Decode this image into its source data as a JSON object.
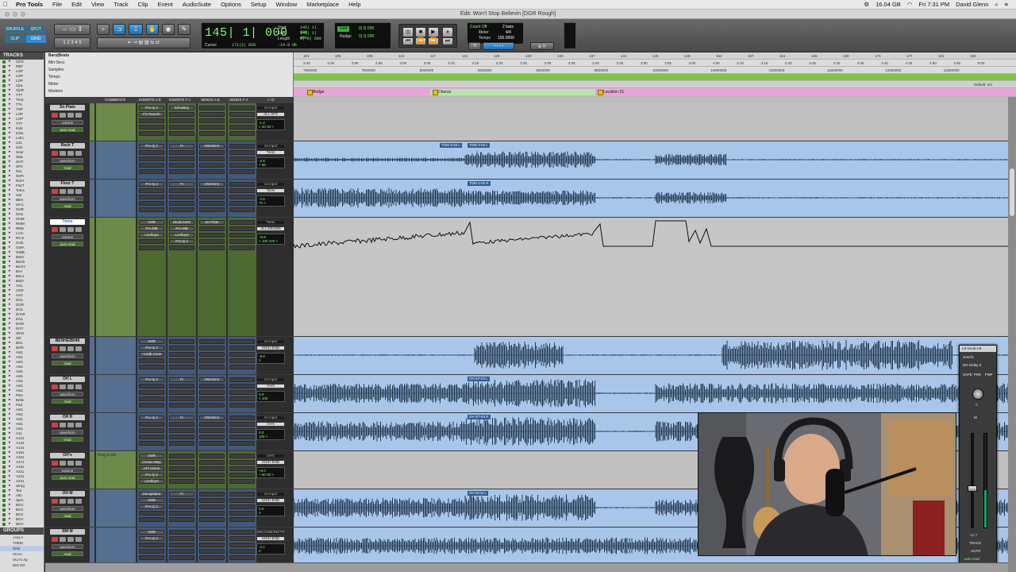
{
  "menubar": {
    "app": "Pro Tools",
    "menus": [
      "File",
      "Edit",
      "View",
      "Track",
      "Clip",
      "Event",
      "AudioSuite",
      "Options",
      "Setup",
      "Window",
      "Marketplace",
      "Help"
    ],
    "status": {
      "disk": "16.04 GB",
      "clock": "Fri 7:31 PM",
      "user": "David Glenn"
    }
  },
  "window": {
    "title": "Edit: Won't Stop Believin [DGR Rough]"
  },
  "toolbar": {
    "modes": [
      "SHUFFLE",
      "SPOT",
      "SLIP",
      "GRID"
    ],
    "counter_main": "145| 1| 000",
    "counter_labels": [
      "Start",
      "End",
      "Length"
    ],
    "counter_values": [
      "145| 1| 000",
      "145| 1| 000",
      "0| 0| 000"
    ],
    "cursor_label": "Cursor",
    "cursor_value": "171|2| 820",
    "cursor_db": "-14.0 db",
    "grid_label": "Grid",
    "grid_value": "0| 2| 000",
    "nudge_label": "Nudge",
    "nudge_value": "0| 1| 000",
    "countoff": "Count Off",
    "countoff_bars": "2 bars",
    "meter_label": "Meter",
    "meter_value": "4/4",
    "tempo_label": "Tempo",
    "tempo_value": "150.0000"
  },
  "tracks_panel": {
    "header": "TRACKS",
    "items": [
      "Click",
      "REF",
      "LOP",
      "LOP",
      "LOP",
      "ClpL",
      "ClpR",
      "TTT",
      "TrnS",
      "TTA",
      "TSP",
      "LOP",
      "LOP",
      "TTT",
      "Kick",
      "KckL",
      "LoKc",
      "U11",
      "Kick",
      "Snar",
      "SML",
      "SnTr",
      "SPC",
      "SnL",
      "SnPt",
      "RckT",
      "FlorT",
      "Toms",
      "Hat",
      "BEH",
      "OH L",
      "OHR",
      "OHs",
      "OHM",
      "RMM",
      "RMS",
      "LCm",
      "RCm",
      "Crsh",
      "GWA",
      "GWB",
      "BsDI",
      "BsCb",
      "BsAm",
      "BsA",
      "BsLn",
      "BsDr",
      "AGL",
      "AGR",
      "AcG",
      "DGL",
      "DGR",
      "DGL",
      "DrmR",
      "DGL",
      "DGR",
      "DGT",
      "SlrGt",
      "Sl2",
      "BGL",
      "BGR",
      "Ast1",
      "Ast1",
      "Ast1",
      "Ast1",
      "Ast1",
      "Ast1",
      "Ast1",
      "Ast1",
      "Ast1",
      "Plan",
      "Belle",
      "Pad",
      "Ast1",
      "Ast1",
      "Ast1",
      "Ast1",
      "Ast1",
      "A11",
      "A121",
      "A131",
      "A141",
      "A151",
      "A161",
      "A171",
      "A181",
      "A211",
      "A221",
      "A231",
      "Strng",
      "Ten",
      "Alto",
      "Sprn",
      "BGV",
      "BGV",
      "BGV",
      "BGV",
      "BGV"
    ]
  },
  "groups_panel": {
    "header": "GROUPS",
    "items": [
      "<ALL>",
      "TOMS",
      "OHs",
      "VCAs",
      "VCA's Ap",
      "Dist Grt"
    ]
  },
  "rulers": {
    "labels": [
      "Bars|Beats",
      "Min:Secs",
      "Samples",
      "Tempo",
      "Meter",
      "Markers"
    ],
    "bars": [
      "101",
      "105",
      "109",
      "113",
      "117",
      "121",
      "125",
      "129",
      "133",
      "137",
      "141",
      "145",
      "149",
      "153",
      "157",
      "161",
      "165",
      "169",
      "173",
      "177",
      "181",
      "185"
    ],
    "mins": [
      "2:40",
      "2:45",
      "2:50",
      "2:55",
      "3:00",
      "3:05",
      "3:10",
      "3:15",
      "3:20",
      "3:25",
      "3:30",
      "3:35",
      "3:40",
      "3:45",
      "3:50",
      "3:55",
      "4:00",
      "4:05",
      "4:10",
      "4:15",
      "4:20",
      "4:25",
      "4:30",
      "4:35",
      "4:40",
      "4:45",
      "4:50",
      "4:55",
      "5:00"
    ],
    "samples": [
      "7000000",
      "7500000",
      "8000000",
      "8500000",
      "9000000",
      "9500000",
      "10000000",
      "10500000",
      "11000000",
      "11500000",
      "12000000",
      "12500000"
    ],
    "meter_default": "Default: 4/4",
    "markers": [
      {
        "name": "Bridge",
        "color": "#e7a6d7"
      },
      {
        "name": "Chorus",
        "color": "#b7e6a9"
      },
      {
        "name": "Location 15",
        "color": "#e7a6d7"
      }
    ]
  },
  "column_headers": [
    "COMMENTS",
    "INSERTS A-E",
    "INSERTS F-J",
    "SENDS A-E",
    "SENDS F-J",
    "I / O"
  ],
  "edit_tracks": [
    {
      "name": "Sn Plate",
      "type": "empty",
      "view": "volume",
      "mode": "auto read",
      "color": "#6d8a4b",
      "comment": "",
      "inserts_ae": [
        "Pro-Q 2",
        "FX Reverb"
      ],
      "inserts_fj": [
        "EchoBoy"
      ],
      "sends_ae": [],
      "io": [
        "no input",
        "ALL SFX"
      ],
      "vol": "-1.4",
      "pan": "< 30   30 >",
      "clips": []
    },
    {
      "name": "Rack T",
      "type": "audio",
      "view": "waveform",
      "mode": "read",
      "color": "#556f90",
      "comment": "",
      "inserts_ae": [
        "Pro-Q 2"
      ],
      "inserts_fj": [
        "FI"
      ],
      "sends_ae": [
        "OWADrm"
      ],
      "io": [
        "no input",
        "Toms"
      ],
      "vol": "-2.6",
      "pan": "< 60",
      "clips": [
        "TOM 3-04 L",
        "TOM 3-04 L"
      ]
    },
    {
      "name": "Floor T",
      "type": "audio",
      "view": "waveform",
      "mode": "read",
      "color": "#556f90",
      "comment": "",
      "inserts_ae": [
        "Pro-Q 2"
      ],
      "inserts_fj": [
        "FI"
      ],
      "sends_ae": [
        "OWADrm"
      ],
      "io": [
        "no input",
        "Toms"
      ],
      "vol": "-2.6",
      "pan": "70 >",
      "clips": [
        "TOM 4-04 R"
      ]
    },
    {
      "name": "Toms",
      "type": "automation",
      "view": "volume",
      "mode": "auto read",
      "color": "#6d8a4b",
      "comment": "",
      "inserts_ae": [
        "VMR",
        "Pro-MB",
        "L2Alloy3"
      ],
      "inserts_fj": [
        "StudioVerb",
        "Pro-MB",
        "L2Alloy3",
        "Pro-Q 2"
      ],
      "sends_ae": [
        "Sn Plate"
      ],
      "io": [
        "Toms",
        "ALL DRUMS"
      ],
      "vol": "+0.6",
      "pan": "< 100   100 >",
      "clips": []
    },
    {
      "name": "BENHEIB040",
      "type": "audio",
      "view": "waveform",
      "mode": "read",
      "color": "#556f90",
      "comment": "",
      "inserts_ae": [
        "VMR",
        "Pro-Q 2",
        "+10db Cons"
      ],
      "inserts_fj": [],
      "sends_ae": [],
      "io": [
        "no input",
        "HIGH END"
      ],
      "vol": "-8.8",
      "pan": "0",
      "clips": []
    },
    {
      "name": "OH L",
      "type": "audio",
      "view": "waveform",
      "mode": "read",
      "color": "#556f90",
      "comment": "",
      "inserts_ae": [
        "Pro-Q 2"
      ],
      "inserts_fj": [
        "FI"
      ],
      "sends_ae": [
        "OWADrm"
      ],
      "io": [
        "no input",
        "OH's"
      ],
      "vol": "0.0",
      "pan": "< 100",
      "clips": [
        "OH ST-04 L"
      ]
    },
    {
      "name": "OH R",
      "type": "audio",
      "view": "waveform",
      "mode": "read",
      "color": "#556f90",
      "comment": "",
      "inserts_ae": [
        "Pro-Q 2"
      ],
      "inserts_fj": [
        "FI"
      ],
      "sends_ae": [
        "OWADrm"
      ],
      "io": [
        "no input",
        "OH's"
      ],
      "vol": "0.0",
      "pan": "100 >",
      "clips": [
        "OH ST-04 R"
      ]
    },
    {
      "name": "OH's",
      "type": "empty",
      "view": "volume",
      "mode": "auto read",
      "color": "#6d8a4b",
      "comment": "ProQ is MS",
      "inserts_ae": [
        "VMR",
        "Ocean Way",
        "API Vision",
        "Pro-Q 2",
        "L2Alloy3"
      ],
      "inserts_fj": [],
      "sends_ae": [],
      "io": [
        "OH's",
        "HIGH END"
      ],
      "vol": "+6.0",
      "pan": "< 80   80 >",
      "clips": []
    },
    {
      "name": "OH M",
      "type": "audio",
      "view": "waveform",
      "mode": "read",
      "color": "#556f90",
      "comment": "",
      "inserts_ae": [
        "Decapitator",
        "VMR",
        "Pro-Q 2"
      ],
      "inserts_fj": [
        "FI"
      ],
      "sends_ae": [],
      "io": [
        "no input",
        "HIGH END"
      ],
      "vol": "0.0",
      "pan": "0",
      "clips": [
        "OH M-04 L"
      ]
    },
    {
      "name": "RM M",
      "type": "audio",
      "view": "waveform",
      "mode": "read",
      "color": "#556f90",
      "comment": "",
      "inserts_ae": [
        "VMR",
        "Pro-Q 2"
      ],
      "inserts_fj": [],
      "sends_ae": [],
      "io": [
        "MIC/LINE/INSTR",
        "HIGH END"
      ],
      "vol": "-4.1",
      "pan": "0",
      "clips": []
    }
  ],
  "float_window": {
    "title": "Ld Vocal Lst",
    "send": "send b",
    "plugin": "DG Delay II",
    "flags": [
      "SAFE",
      "PRE",
      "FMP"
    ],
    "level": "0",
    "readout": "-22.7",
    "track_label": "TRACK",
    "mode_label": "AUTO",
    "mode_value": "auto read"
  },
  "colors": {
    "audio_lane": "#a8c6ea",
    "waveform": "#22384f",
    "automation_lane": "#c6c6c6",
    "selected_track_text": "#2a6bd0",
    "counter_green": "#7fff6b"
  }
}
